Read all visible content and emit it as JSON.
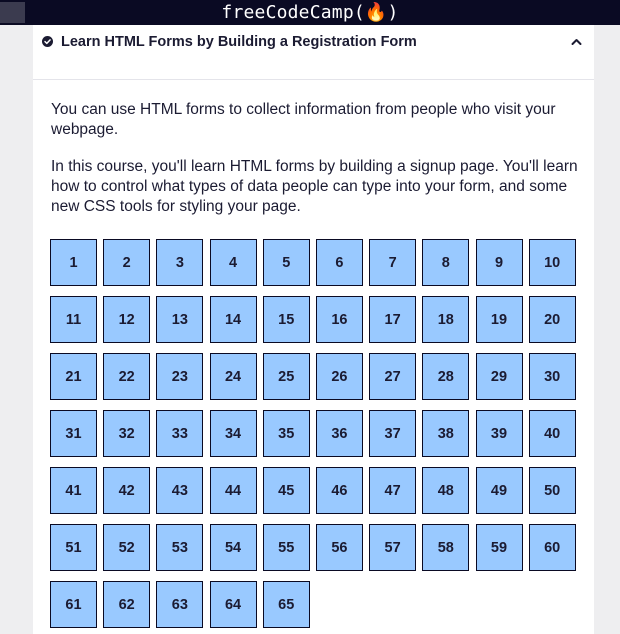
{
  "navbar": {
    "brand": "freeCodeCamp(🔥)"
  },
  "block": {
    "title": "Learn HTML Forms by Building a Registration Form",
    "description_1": "You can use HTML forms to collect information from people who visit your webpage.",
    "description_2": "In this course, you'll learn HTML forms by building a signup page. You'll learn how to control what types of data people can type into your form, and some new CSS tools for styling your page.",
    "completed_icon": "check-circle-icon",
    "toggle_icon": "chevron-up-icon"
  },
  "steps": [
    "1",
    "2",
    "3",
    "4",
    "5",
    "6",
    "7",
    "8",
    "9",
    "10",
    "11",
    "12",
    "13",
    "14",
    "15",
    "16",
    "17",
    "18",
    "19",
    "20",
    "21",
    "22",
    "23",
    "24",
    "25",
    "26",
    "27",
    "28",
    "29",
    "30",
    "31",
    "32",
    "33",
    "34",
    "35",
    "36",
    "37",
    "38",
    "39",
    "40",
    "41",
    "42",
    "43",
    "44",
    "45",
    "46",
    "47",
    "48",
    "49",
    "50",
    "51",
    "52",
    "53",
    "54",
    "55",
    "56",
    "57",
    "58",
    "59",
    "60",
    "61",
    "62",
    "63",
    "64",
    "65"
  ],
  "colors": {
    "step_bg": "#99c9ff",
    "step_border": "#0a0a23",
    "navbar_bg": "#0a0a23",
    "text": "#1b1b32"
  }
}
